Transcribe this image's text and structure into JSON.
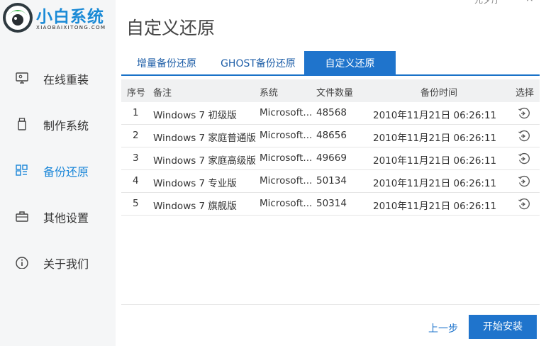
{
  "app": {
    "logo_title": "小白系统",
    "logo_subtitle": "XIAOBAIXITONG.COM",
    "brand_color": "#1a8ad6"
  },
  "sidebar": {
    "items": [
      {
        "label": "在线重装",
        "icon": "monitor-icon",
        "active": false
      },
      {
        "label": "制作系统",
        "icon": "usb-drive-icon",
        "active": false
      },
      {
        "label": "备份还原",
        "icon": "backup-grid-icon",
        "active": true
      },
      {
        "label": "其他设置",
        "icon": "toolbox-icon",
        "active": false
      },
      {
        "label": "关于我们",
        "icon": "info-icon",
        "active": false
      }
    ]
  },
  "header": {
    "title": "自定义还原",
    "top_link": "元夕厅",
    "close": "×"
  },
  "tabs": [
    {
      "label": "增量备份还原",
      "active": false
    },
    {
      "label": "GHOST备份还原",
      "active": false
    },
    {
      "label": "自定义还原",
      "active": true
    }
  ],
  "table": {
    "columns": [
      "序号",
      "备注",
      "系统",
      "文件数量",
      "备份时间",
      "选择"
    ],
    "rows": [
      {
        "index": "1",
        "note": "Windows 7 初级版",
        "system": "Microsoft...",
        "files": "48568",
        "time": "2010年11月21日 06:26:11"
      },
      {
        "index": "2",
        "note": "Windows 7 家庭普通版",
        "system": "Microsoft...",
        "files": "48656",
        "time": "2010年11月21日 06:26:11"
      },
      {
        "index": "3",
        "note": "Windows 7 家庭高级版",
        "system": "Microsoft...",
        "files": "49669",
        "time": "2010年11月21日 06:26:11"
      },
      {
        "index": "4",
        "note": "Windows 7 专业版",
        "system": "Microsoft...",
        "files": "50134",
        "time": "2010年11月21日 06:26:11"
      },
      {
        "index": "5",
        "note": "Windows 7 旗舰版",
        "system": "Microsoft...",
        "files": "50314",
        "time": "2010年11月21日 06:26:11"
      }
    ]
  },
  "footer": {
    "prev_label": "上一步",
    "install_label": "开始安装"
  },
  "colors": {
    "accent": "#1f74cc",
    "sidebar_bg": "#f5f6f7"
  }
}
